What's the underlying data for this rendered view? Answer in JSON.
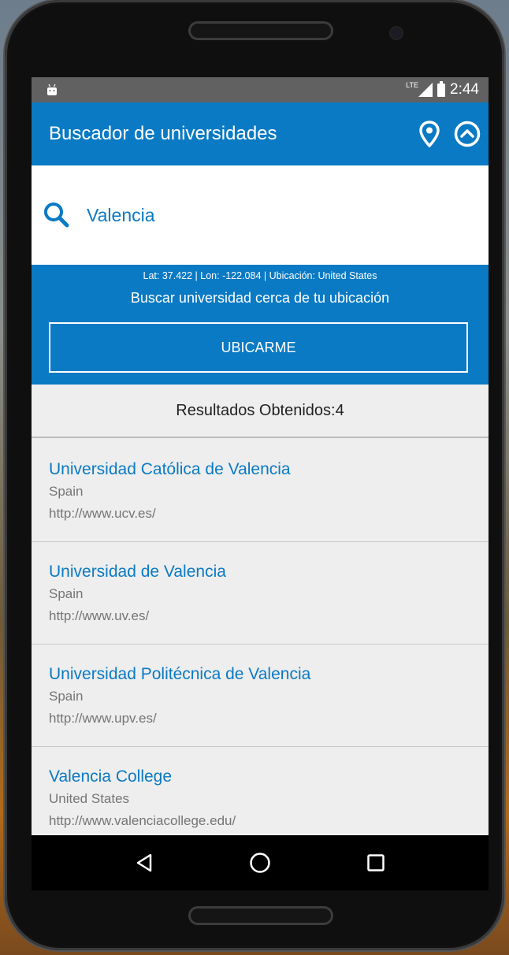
{
  "status_bar": {
    "network": "LTE",
    "time": "2:44"
  },
  "app_bar": {
    "title": "Buscador de universidades"
  },
  "search": {
    "value": "Valencia",
    "icon": "search-icon"
  },
  "location_panel": {
    "coords": "Lat: 37.422 | Lon: -122.084 | Ubicación: United States",
    "subtitle": "Buscar universidad cerca de tu ubicación",
    "button_label": "UBICARME"
  },
  "results": {
    "header": "Resultados Obtenidos:4",
    "items": [
      {
        "name": "Universidad Católica de Valencia",
        "country": "Spain",
        "url": "http://www.ucv.es/"
      },
      {
        "name": "Universidad de Valencia",
        "country": "Spain",
        "url": "http://www.uv.es/"
      },
      {
        "name": "Universidad Politécnica de Valencia",
        "country": "Spain",
        "url": "http://www.upv.es/"
      },
      {
        "name": "Valencia College",
        "country": "United States",
        "url": "http://www.valenciacollege.edu/"
      }
    ]
  },
  "colors": {
    "primary": "#0a7ac4",
    "status_bar": "#616161",
    "list_bg": "#eeeeee",
    "secondary_text": "#757575"
  },
  "icons": {
    "location_pin": "location-pin-icon",
    "collapse": "chevron-up-circle-icon",
    "back": "back-triangle-icon",
    "home": "home-circle-icon",
    "recents": "recents-square-icon"
  }
}
